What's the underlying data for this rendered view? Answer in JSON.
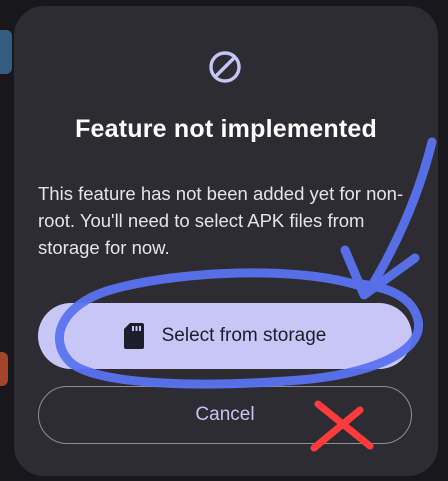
{
  "dialog": {
    "icon": "block-icon",
    "title": "Feature not implemented",
    "message": "This feature has not been added yet for non-root. You'll need to select APK files from storage for now.",
    "primary_button": {
      "label": "Select from storage",
      "icon": "sd-card-icon"
    },
    "secondary_button": {
      "label": "Cancel"
    }
  },
  "colors": {
    "dialog_bg": "#2d2c33",
    "primary_button_bg": "#c8c6f7",
    "secondary_text": "#c7c4f5",
    "annotation_blue": "#5a73f0",
    "annotation_red": "#ff3b3b"
  },
  "annotations": {
    "circle_around": "primary-button",
    "arrow_color": "annotation_blue",
    "x_mark_on": "cancel-button"
  }
}
